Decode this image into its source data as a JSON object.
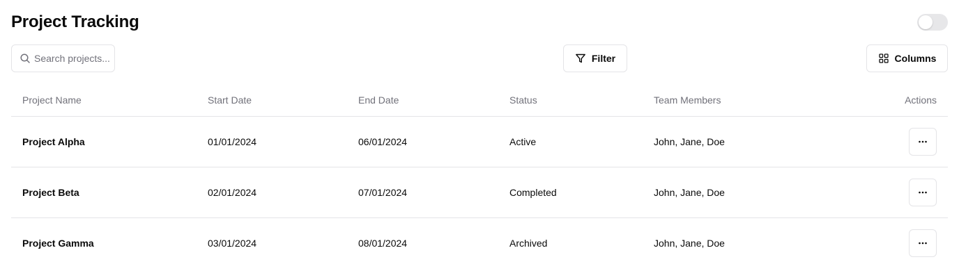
{
  "header": {
    "title": "Project Tracking"
  },
  "toggle": {
    "on": false
  },
  "toolbar": {
    "search_placeholder": "Search projects...",
    "filter_label": "Filter",
    "filter_icon": "filter-funnel-icon",
    "columns_label": "Columns",
    "columns_icon": "grid-icon",
    "search_icon": "search-icon"
  },
  "table": {
    "columns": [
      "Project Name",
      "Start Date",
      "End Date",
      "Status",
      "Team Members",
      "Actions"
    ],
    "rows": [
      {
        "name": "Project Alpha",
        "start": "01/01/2024",
        "end": "06/01/2024",
        "status": "Active",
        "members": "John, Jane, Doe"
      },
      {
        "name": "Project Beta",
        "start": "02/01/2024",
        "end": "07/01/2024",
        "status": "Completed",
        "members": "John, Jane, Doe"
      },
      {
        "name": "Project Gamma",
        "start": "03/01/2024",
        "end": "08/01/2024",
        "status": "Archived",
        "members": "John, Jane, Doe"
      }
    ],
    "row_action_icon": "more-horizontal-icon"
  }
}
